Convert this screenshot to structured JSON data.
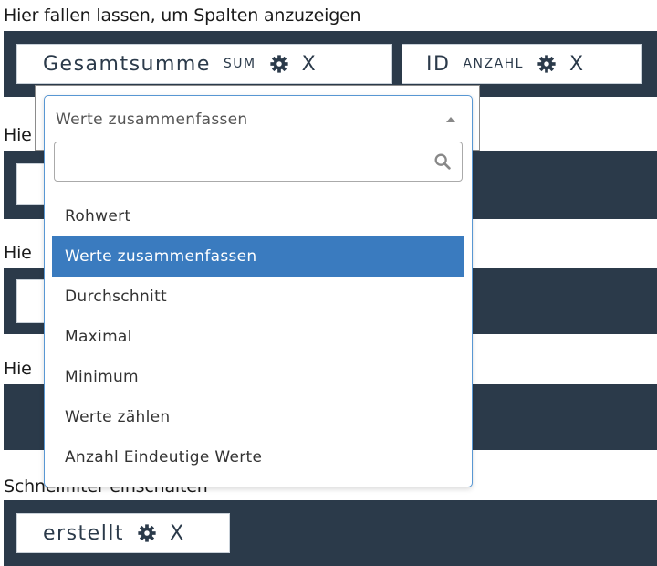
{
  "columns_zone": {
    "label": "Hier fallen lassen, um Spalten anzuzeigen",
    "chips": [
      {
        "name": "Gesamtsumme",
        "aggregation": "SUM",
        "remove": "X"
      },
      {
        "name": "ID",
        "aggregation": "ANZAHL",
        "remove": "X"
      }
    ]
  },
  "zone2": {
    "label": "Hie"
  },
  "zone3": {
    "label": "Hie"
  },
  "zone4": {
    "label": "Hie"
  },
  "filter_zone": {
    "label": "Schnellfilter einschalten",
    "chips": [
      {
        "name": "erstellt",
        "remove": "X"
      }
    ]
  },
  "dropdown": {
    "selected_label": "Werte zusammenfassen",
    "search_placeholder": "",
    "options": [
      "Rohwert",
      "Werte zusammenfassen",
      "Durchschnitt",
      "Maximal",
      "Minimum",
      "Werte zählen",
      "Anzahl Eindeutige Werte"
    ],
    "selected_index": 1
  },
  "colors": {
    "bar": "#2b3a4a",
    "selected": "#3a7bbf",
    "dropdown_border": "#5897d3"
  },
  "icons": {
    "gear": "gear-icon",
    "search": "search-icon",
    "remove": "close-icon"
  }
}
